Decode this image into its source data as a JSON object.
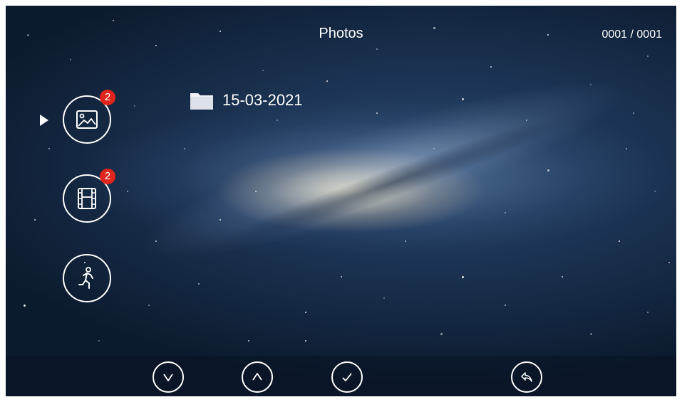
{
  "header": {
    "title": "Photos",
    "counter": "0001 / 0001"
  },
  "sidebar": {
    "items": [
      {
        "name": "photos",
        "icon": "image-icon",
        "badge": "2",
        "selected": true
      },
      {
        "name": "videos",
        "icon": "film-icon",
        "badge": "2",
        "selected": false
      },
      {
        "name": "motion",
        "icon": "running-person-icon",
        "badge": null,
        "selected": false
      }
    ]
  },
  "main": {
    "folders": [
      {
        "name": "15-03-2021",
        "icon": "folder-icon"
      }
    ]
  },
  "toolbar": {
    "buttons": [
      {
        "name": "down",
        "icon": "chevron-down-icon"
      },
      {
        "name": "up",
        "icon": "chevron-up-icon"
      },
      {
        "name": "confirm",
        "icon": "check-icon"
      },
      {
        "name": "back",
        "icon": "return-arrow-icon"
      }
    ]
  },
  "colors": {
    "badge": "#e0251c",
    "foreground": "#ffffff",
    "background": "#1b3352"
  }
}
